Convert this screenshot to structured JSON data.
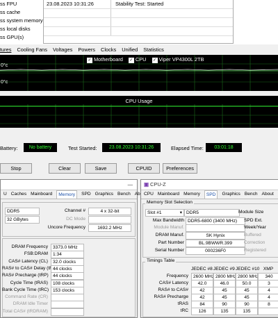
{
  "stress_options": [
    "ss FPU",
    "ss cache",
    "ss system memory",
    "ss local disks",
    "ss GPU(s)"
  ],
  "log": {
    "datetime": "23.08.2023 10:31:26",
    "event": "Stability Test: Started"
  },
  "tabs": [
    "tures",
    "Cooling Fans",
    "Voltages",
    "Powers",
    "Clocks",
    "Unified",
    "Statistics"
  ],
  "graph1": {
    "legend": [
      "Motherboard",
      "CPU",
      "Viper VP4300L 2TB"
    ],
    "label_top": "0°c",
    "label_bottom": "0°c"
  },
  "graph2": {
    "title": "CPU Usage"
  },
  "status": {
    "battery_label": "Battery:",
    "battery_value": "No battery",
    "test_started_label": "Test Started:",
    "test_started_value": "23.08.2023 10:31:26",
    "elapsed_label": "Elapsed Time:",
    "elapsed_value": "03:01:18"
  },
  "buttons": {
    "stop": "Stop",
    "clear": "Clear",
    "save": "Save",
    "cpuid": "CPUID",
    "preferences": "Preferences"
  },
  "cpuz_left": {
    "tabs": [
      "U",
      "Caches",
      "Mainboard",
      "Memory",
      "SPD",
      "Graphics",
      "Bench",
      "About"
    ],
    "type": "DDR5",
    "size": "32 GBytes",
    "channel_label": "Channel #",
    "channel": "4 x 32-bit",
    "dc_label": "DC Mode",
    "uncore_label": "Uncore Frequency",
    "uncore": "1692.2 MHz",
    "timings": [
      {
        "label": "DRAM Frequency",
        "value": "3373.0 MHz"
      },
      {
        "label": "FSB:DRAM",
        "value": "1:34"
      },
      {
        "label": "CAS# Latency (CL)",
        "value": "32.0 clocks"
      },
      {
        "label": "RAS# to CAS# Delay (tRCD)",
        "value": "44 clocks"
      },
      {
        "label": "RAS# Precharge (tRP)",
        "value": "44 clocks"
      },
      {
        "label": "Cycle Time (tRAS)",
        "value": "108 clocks"
      },
      {
        "label": "Bank Cycle Time (tRC)",
        "value": "153 clocks"
      },
      {
        "label": "Command Rate (CR)",
        "value": ""
      },
      {
        "label": "DRAM Idle Timer",
        "value": ""
      },
      {
        "label": "Total CAS# (tRDRAM)",
        "value": ""
      }
    ]
  },
  "cpuz_right": {
    "title": "CPU-Z",
    "tabs": [
      "CPU",
      "Mainboard",
      "Memory",
      "SPD",
      "Graphics",
      "Bench",
      "About"
    ],
    "slot_group": "Memory Slot Selection",
    "slot": "Slot #1",
    "type": "DDR5",
    "module_size_label": "Module Size",
    "max_bw_label": "Max Bandwidth",
    "max_bw": "DDR5-6800 (3400 MHz)",
    "spd_ext_label": "SPD Ext.",
    "module_manuf_label": "Module Manuf.",
    "week_year_label": "Week/Year",
    "dram_manuf_label": "DRAM Manuf.",
    "dram_manuf": "SK Hynix",
    "buffered_label": "Buffered",
    "part_label": "Part Number",
    "part": "BL.9BWWR.399",
    "correction_label": "Correction",
    "serial_label": "Serial Number",
    "serial": "000236F0",
    "registered_label": "Registered",
    "timings_group": "Timings Table",
    "cols": [
      "JEDEC #8",
      "JEDEC #9",
      "JEDEC #10",
      "XMP"
    ],
    "rows": [
      {
        "label": "Frequency",
        "vals": [
          "2600 MHz",
          "2800 MHz",
          "2800 MHz",
          "340"
        ]
      },
      {
        "label": "CAS# Latency",
        "vals": [
          "42.0",
          "46.0",
          "50.0",
          "3"
        ]
      },
      {
        "label": "RAS# to CAS#",
        "vals": [
          "42",
          "45",
          "45",
          "4"
        ]
      },
      {
        "label": "RAS# Precharge",
        "vals": [
          "42",
          "45",
          "45",
          "4"
        ]
      },
      {
        "label": "tRAS",
        "vals": [
          "84",
          "90",
          "90",
          "8"
        ]
      },
      {
        "label": "tRC",
        "vals": [
          "126",
          "135",
          "135",
          ""
        ]
      }
    ]
  },
  "colors": {
    "graph_bg": "#000000",
    "grid": "#1a6b1a",
    "status_text": "#33ff33"
  }
}
